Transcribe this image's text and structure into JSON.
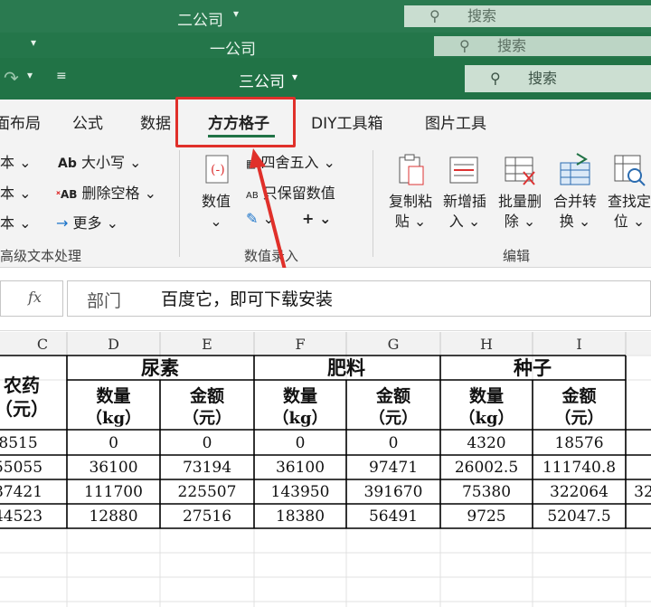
{
  "windows": [
    {
      "title": "二公司",
      "search": "搜索"
    },
    {
      "title": "一公司",
      "search": "搜索"
    },
    {
      "title": "三公司",
      "search": "搜索"
    }
  ],
  "tabs": [
    {
      "label": "页面布局",
      "shown": "面布局"
    },
    {
      "label": "公式"
    },
    {
      "label": "数据",
      "shown": "数据"
    },
    {
      "label": "方方格子",
      "active": true
    },
    {
      "label": "DIY工具箱"
    },
    {
      "label": "图片工具"
    }
  ],
  "ribbon": {
    "text_group": {
      "items": [
        "本",
        "本",
        "本"
      ],
      "case_label": "大小写",
      "remove_spaces_label": "删除空格",
      "more_label": "更多",
      "group_label": "高级文本处理"
    },
    "number_group": {
      "value_label": "数值",
      "round_label": "四舍五入",
      "keep_values_label": "只保留数值",
      "group_label": "数值录入"
    },
    "edit_group": {
      "buttons": [
        {
          "line1": "复制粘",
          "line2": "贴"
        },
        {
          "line1": "新增插",
          "line2": "入"
        },
        {
          "line1": "批量删",
          "line2": "除"
        },
        {
          "line1": "合并转",
          "line2": "换"
        },
        {
          "line1": "查找定",
          "line2": "位"
        }
      ],
      "group_label": "编辑"
    }
  },
  "formula_bar": {
    "fx": "fx",
    "cell_value": "部门",
    "overlay_text": "百度它，即可下载安装"
  },
  "columns": [
    "C",
    "D",
    "E",
    "F",
    "G",
    "H",
    "I"
  ],
  "headers": {
    "c_label": "农药（元）",
    "groups": [
      "尿素",
      "肥料",
      "种子"
    ],
    "qty": "数量",
    "qty_unit": "（kg）",
    "amt": "金额",
    "amt_unit": "（元）"
  },
  "rows": [
    [
      "8515",
      "0",
      "0",
      "0",
      "0",
      "4320",
      "18576",
      ""
    ],
    [
      "55055",
      "36100",
      "73194",
      "36100",
      "97471",
      "26002.5",
      "111740.8",
      ""
    ],
    [
      "87421",
      "111700",
      "225507",
      "143950",
      "391670",
      "75380",
      "322064",
      "32"
    ],
    [
      "44523",
      "12880",
      "27516",
      "18380",
      "56491",
      "9725",
      "52047.5",
      ""
    ]
  ],
  "colors": {
    "excel_green": "#217346",
    "highlight": "#e0302a"
  }
}
